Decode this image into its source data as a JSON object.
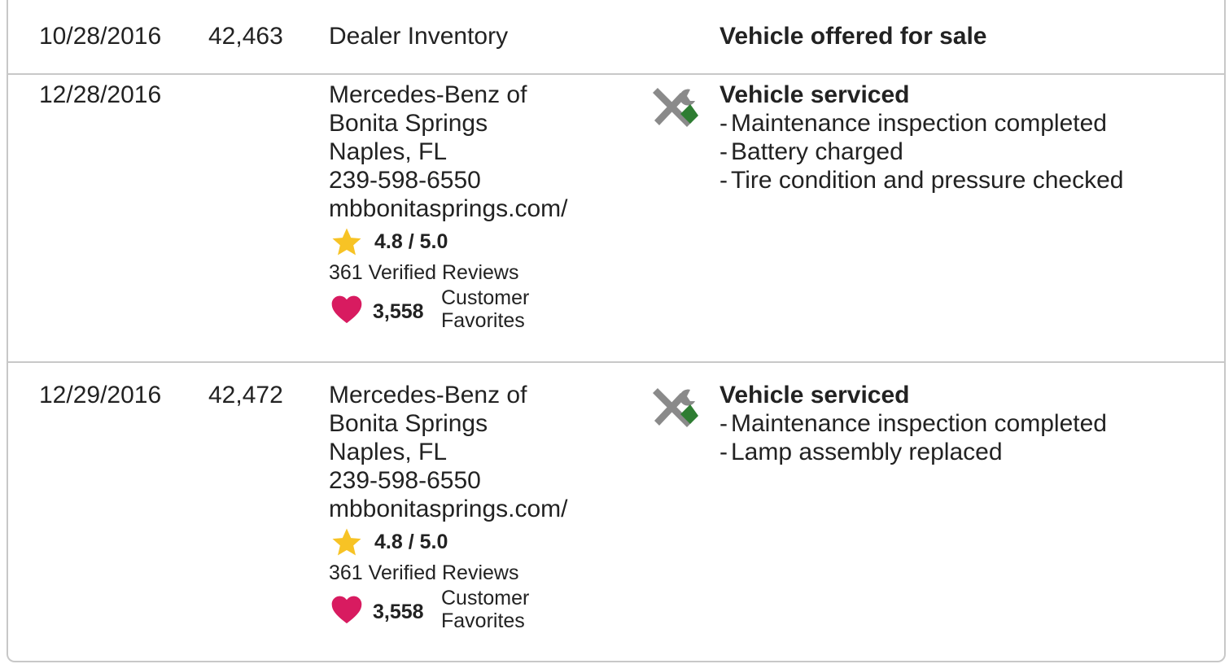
{
  "rows": [
    {
      "date": "10/28/2016",
      "odometer": "42,463",
      "source": [
        "Dealer Inventory"
      ],
      "event_title": "Vehicle offered for sale",
      "event_items": []
    },
    {
      "date": "12/28/2016",
      "odometer": "",
      "source": [
        "Mercedes-Benz of",
        "Bonita Springs",
        "Naples, FL",
        "239-598-6550",
        "mbbonitasprings.com/"
      ],
      "rating": "4.8 / 5.0",
      "reviews": "361 Verified Reviews",
      "favorites_count": "3,558",
      "favorites_label_1": "Customer",
      "favorites_label_2": "Favorites",
      "icon": "tools-icon",
      "event_title": "Vehicle serviced",
      "event_items": [
        "Maintenance inspection completed",
        "Battery charged",
        "Tire condition and pressure checked"
      ]
    },
    {
      "date": "12/29/2016",
      "odometer": "42,472",
      "source": [
        "Mercedes-Benz of",
        "Bonita Springs",
        "Naples, FL",
        "239-598-6550",
        "mbbonitasprings.com/"
      ],
      "rating": "4.8 / 5.0",
      "reviews": "361 Verified Reviews",
      "favorites_count": "3,558",
      "favorites_label_1": "Customer",
      "favorites_label_2": "Favorites",
      "icon": "tools-icon",
      "event_title": "Vehicle serviced",
      "event_items": [
        "Maintenance inspection completed",
        "Lamp assembly replaced"
      ]
    }
  ],
  "colors": {
    "star": "#f7c325",
    "heart": "#d81b60",
    "wrench": "#8a8a8a",
    "screwdriver_handle": "#2e7d32",
    "border": "#c8c8c8"
  }
}
